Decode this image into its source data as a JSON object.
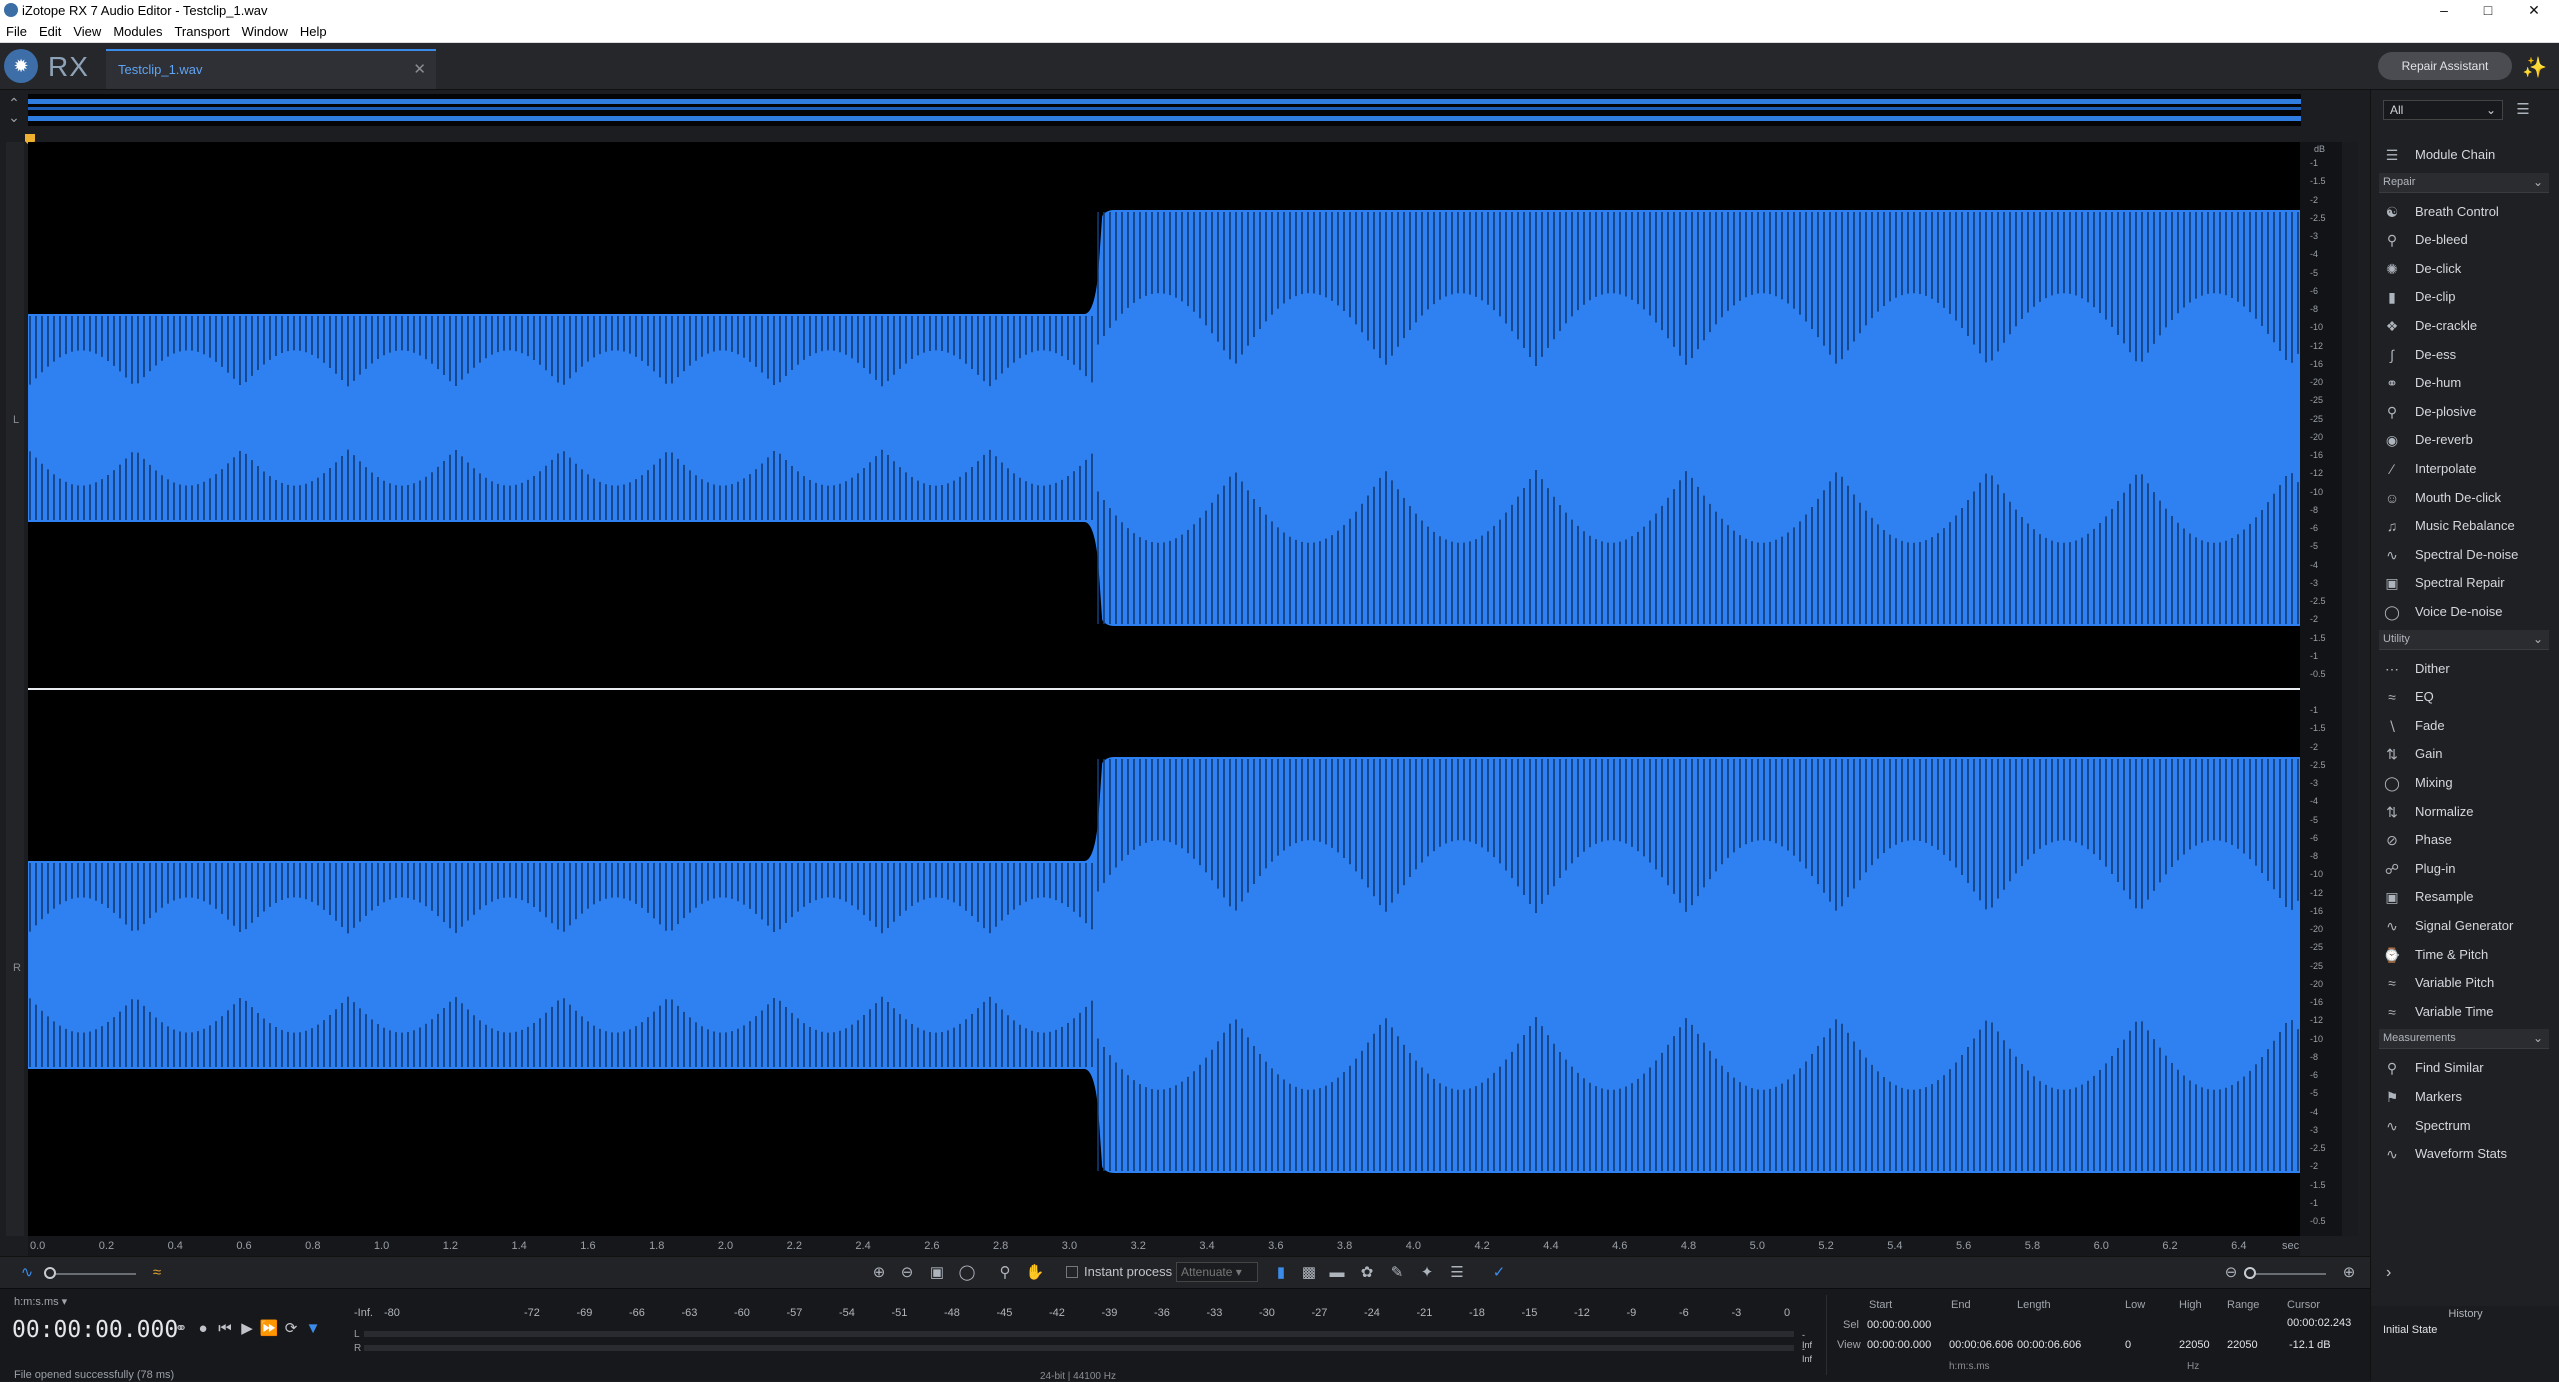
{
  "window": {
    "title": "iZotope RX 7 Audio Editor - Testclip_1.wav"
  },
  "menu": [
    "File",
    "Edit",
    "View",
    "Modules",
    "Transport",
    "Window",
    "Help"
  ],
  "app": {
    "logo_text": "RX",
    "file_tab": "Testclip_1.wav",
    "repair_assistant": "Repair Assistant"
  },
  "waveform": {
    "channels": [
      "L",
      "R"
    ],
    "db_unit": "dB",
    "db_ticks": [
      "-1",
      "-1.5",
      "-2",
      "-2.5",
      "-3",
      "-4",
      "-5",
      "-6",
      "-8",
      "-10",
      "-12",
      "-16",
      "-20",
      "-25",
      "-25",
      "-20",
      "-16",
      "-12",
      "-10",
      "-8",
      "-6",
      "-5",
      "-4",
      "-3",
      "-2.5",
      "-2",
      "-1.5",
      "-1",
      "-0.5"
    ],
    "time_ticks": [
      "0.0",
      "0.2",
      "0.4",
      "0.6",
      "0.8",
      "1.0",
      "1.2",
      "1.4",
      "1.6",
      "1.8",
      "2.0",
      "2.2",
      "2.4",
      "2.6",
      "2.8",
      "3.0",
      "3.2",
      "3.4",
      "3.6",
      "3.8",
      "4.0",
      "4.2",
      "4.4",
      "4.6",
      "4.8",
      "5.0",
      "5.2",
      "5.4",
      "5.6",
      "5.8",
      "6.0",
      "6.2",
      "6.4"
    ],
    "time_unit": "sec",
    "color": "#2f80f0",
    "amplitude_change_at_sec": 3.1
  },
  "toolbar": {
    "instant_process": "Instant process",
    "attenuate": "Attenuate"
  },
  "modules": {
    "filter": "All",
    "module_chain": "Module Chain",
    "repair_header": "Repair",
    "repair": [
      "Breath Control",
      "De-bleed",
      "De-click",
      "De-clip",
      "De-crackle",
      "De-ess",
      "De-hum",
      "De-plosive",
      "De-reverb",
      "Interpolate",
      "Mouth De-click",
      "Music Rebalance",
      "Spectral De-noise",
      "Spectral Repair",
      "Voice De-noise"
    ],
    "utility_header": "Utility",
    "utility": [
      "Dither",
      "EQ",
      "Fade",
      "Gain",
      "Mixing",
      "Normalize",
      "Phase",
      "Plug-in",
      "Resample",
      "Signal Generator",
      "Time & Pitch",
      "Variable Pitch",
      "Variable Time"
    ],
    "measurements_header": "Measurements",
    "measurements": [
      "Find Similar",
      "Markers",
      "Spectrum",
      "Waveform Stats"
    ]
  },
  "transport": {
    "format": "h:m:s.ms",
    "timecode": "00:00:00.000",
    "status": "File opened successfully (78 ms)"
  },
  "meter": {
    "scale": [
      "-Inf.",
      "-80",
      "-72",
      "-69",
      "-66",
      "-63",
      "-60",
      "-57",
      "-54",
      "-51",
      "-48",
      "-45",
      "-42",
      "-39",
      "-36",
      "-33",
      "-30",
      "-27",
      "-24",
      "-21",
      "-18",
      "-15",
      "-12",
      "-9",
      "-6",
      "-3",
      "0"
    ],
    "channels": [
      "L",
      "R"
    ],
    "peak_l": "-Inf",
    "peak_r": "-Inf",
    "format_info": "24-bit | 44100 Hz"
  },
  "selection": {
    "headers": {
      "start": "Start",
      "end": "End",
      "length": "Length",
      "low": "Low",
      "high": "High",
      "range": "Range",
      "cursor": "Cursor"
    },
    "sel_label": "Sel",
    "view_label": "View",
    "sel_start": "00:00:00.000",
    "view_start": "00:00:00.000",
    "view_end": "00:00:06.606",
    "view_length": "00:00:06.606",
    "low": "0",
    "high": "22050",
    "range": "22050",
    "cursor_time": "00:00:02.243",
    "cursor_db": "-12.1 dB",
    "time_unit": "h:m:s.ms",
    "freq_unit": "Hz"
  },
  "history": {
    "title": "History",
    "state": "Initial State"
  }
}
